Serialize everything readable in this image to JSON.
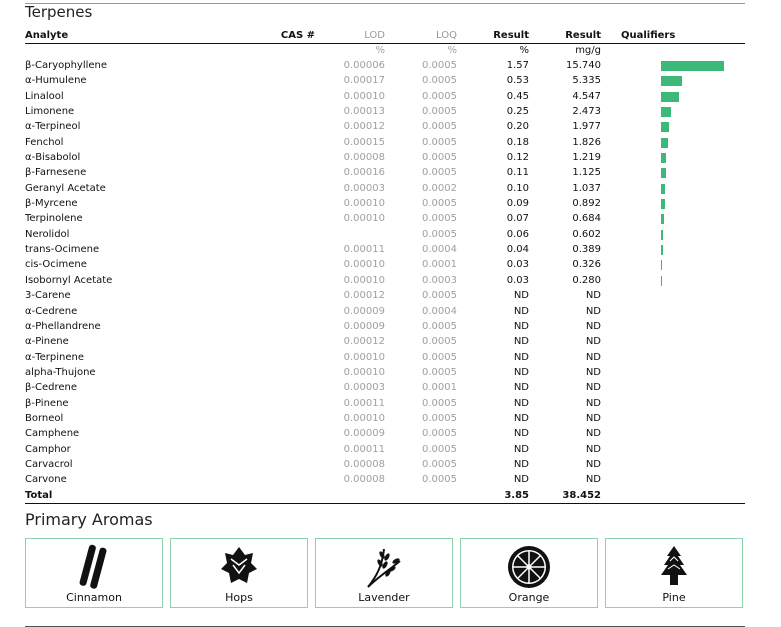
{
  "section": {
    "title": "Terpenes"
  },
  "columns": {
    "analyte": "Analyte",
    "cas": "CAS #",
    "lod": "LOD",
    "loq": "LOQ",
    "result_pct": "Result",
    "result_mg": "Result",
    "qualifiers": "Qualifiers"
  },
  "units": {
    "lod": "%",
    "loq": "%",
    "result_pct": "%",
    "result_mg": "mg/g"
  },
  "rows": [
    {
      "analyte": "β-Caryophyllene",
      "lod": "0.00006",
      "loq": "0.0005",
      "pct": "1.57",
      "mg": "15.740",
      "bar": 15.74
    },
    {
      "analyte": "α-Humulene",
      "lod": "0.00017",
      "loq": "0.0005",
      "pct": "0.53",
      "mg": "5.335",
      "bar": 5.335
    },
    {
      "analyte": "Linalool",
      "lod": "0.00010",
      "loq": "0.0005",
      "pct": "0.45",
      "mg": "4.547",
      "bar": 4.547
    },
    {
      "analyte": "Limonene",
      "lod": "0.00013",
      "loq": "0.0005",
      "pct": "0.25",
      "mg": "2.473",
      "bar": 2.473
    },
    {
      "analyte": "α-Terpineol",
      "lod": "0.00012",
      "loq": "0.0005",
      "pct": "0.20",
      "mg": "1.977",
      "bar": 1.977
    },
    {
      "analyte": "Fenchol",
      "lod": "0.00015",
      "loq": "0.0005",
      "pct": "0.18",
      "mg": "1.826",
      "bar": 1.826
    },
    {
      "analyte": "α-Bisabolol",
      "lod": "0.00008",
      "loq": "0.0005",
      "pct": "0.12",
      "mg": "1.219",
      "bar": 1.219
    },
    {
      "analyte": "β-Farnesene",
      "lod": "0.00016",
      "loq": "0.0005",
      "pct": "0.11",
      "mg": "1.125",
      "bar": 1.125
    },
    {
      "analyte": "Geranyl Acetate",
      "lod": "0.00003",
      "loq": "0.0002",
      "pct": "0.10",
      "mg": "1.037",
      "bar": 1.037
    },
    {
      "analyte": "β-Myrcene",
      "lod": "0.00010",
      "loq": "0.0005",
      "pct": "0.09",
      "mg": "0.892",
      "bar": 0.892
    },
    {
      "analyte": "Terpinolene",
      "lod": "0.00010",
      "loq": "0.0005",
      "pct": "0.07",
      "mg": "0.684",
      "bar": 0.684
    },
    {
      "analyte": "Nerolidol",
      "lod": "",
      "loq": "0.0005",
      "pct": "0.06",
      "mg": "0.602",
      "bar": 0.602
    },
    {
      "analyte": "trans-Ocimene",
      "lod": "0.00011",
      "loq": "0.0004",
      "pct": "0.04",
      "mg": "0.389",
      "bar": 0.389
    },
    {
      "analyte": "cis-Ocimene",
      "lod": "0.00010",
      "loq": "0.0001",
      "pct": "0.03",
      "mg": "0.326",
      "bar": 0.326
    },
    {
      "analyte": "Isobornyl Acetate",
      "lod": "0.00010",
      "loq": "0.0003",
      "pct": "0.03",
      "mg": "0.280",
      "bar": 0.28
    },
    {
      "analyte": "3-Carene",
      "lod": "0.00012",
      "loq": "0.0005",
      "pct": "ND",
      "mg": "ND",
      "bar": 0
    },
    {
      "analyte": "α-Cedrene",
      "lod": "0.00009",
      "loq": "0.0004",
      "pct": "ND",
      "mg": "ND",
      "bar": 0
    },
    {
      "analyte": "α-Phellandrene",
      "lod": "0.00009",
      "loq": "0.0005",
      "pct": "ND",
      "mg": "ND",
      "bar": 0
    },
    {
      "analyte": "α-Pinene",
      "lod": "0.00012",
      "loq": "0.0005",
      "pct": "ND",
      "mg": "ND",
      "bar": 0
    },
    {
      "analyte": "α-Terpinene",
      "lod": "0.00010",
      "loq": "0.0005",
      "pct": "ND",
      "mg": "ND",
      "bar": 0
    },
    {
      "analyte": "alpha-Thujone",
      "lod": "0.00010",
      "loq": "0.0005",
      "pct": "ND",
      "mg": "ND",
      "bar": 0
    },
    {
      "analyte": "β-Cedrene",
      "lod": "0.00003",
      "loq": "0.0001",
      "pct": "ND",
      "mg": "ND",
      "bar": 0
    },
    {
      "analyte": "β-Pinene",
      "lod": "0.00011",
      "loq": "0.0005",
      "pct": "ND",
      "mg": "ND",
      "bar": 0
    },
    {
      "analyte": "Borneol",
      "lod": "0.00010",
      "loq": "0.0005",
      "pct": "ND",
      "mg": "ND",
      "bar": 0
    },
    {
      "analyte": "Camphene",
      "lod": "0.00009",
      "loq": "0.0005",
      "pct": "ND",
      "mg": "ND",
      "bar": 0
    },
    {
      "analyte": "Camphor",
      "lod": "0.00011",
      "loq": "0.0005",
      "pct": "ND",
      "mg": "ND",
      "bar": 0
    },
    {
      "analyte": "Carvacrol",
      "lod": "0.00008",
      "loq": "0.0005",
      "pct": "ND",
      "mg": "ND",
      "bar": 0
    },
    {
      "analyte": "Carvone",
      "lod": "0.00008",
      "loq": "0.0005",
      "pct": "ND",
      "mg": "ND",
      "bar": 0
    }
  ],
  "total": {
    "label": "Total",
    "pct": "3.85",
    "mg": "38.452"
  },
  "bar_color": "#3cb878",
  "aromas": {
    "title": "Primary Aromas",
    "items": [
      {
        "label": "Cinnamon",
        "icon": "cinnamon-icon"
      },
      {
        "label": "Hops",
        "icon": "hops-icon"
      },
      {
        "label": "Lavender",
        "icon": "lavender-icon"
      },
      {
        "label": "Orange",
        "icon": "orange-icon"
      },
      {
        "label": "Pine",
        "icon": "pine-icon"
      }
    ]
  }
}
